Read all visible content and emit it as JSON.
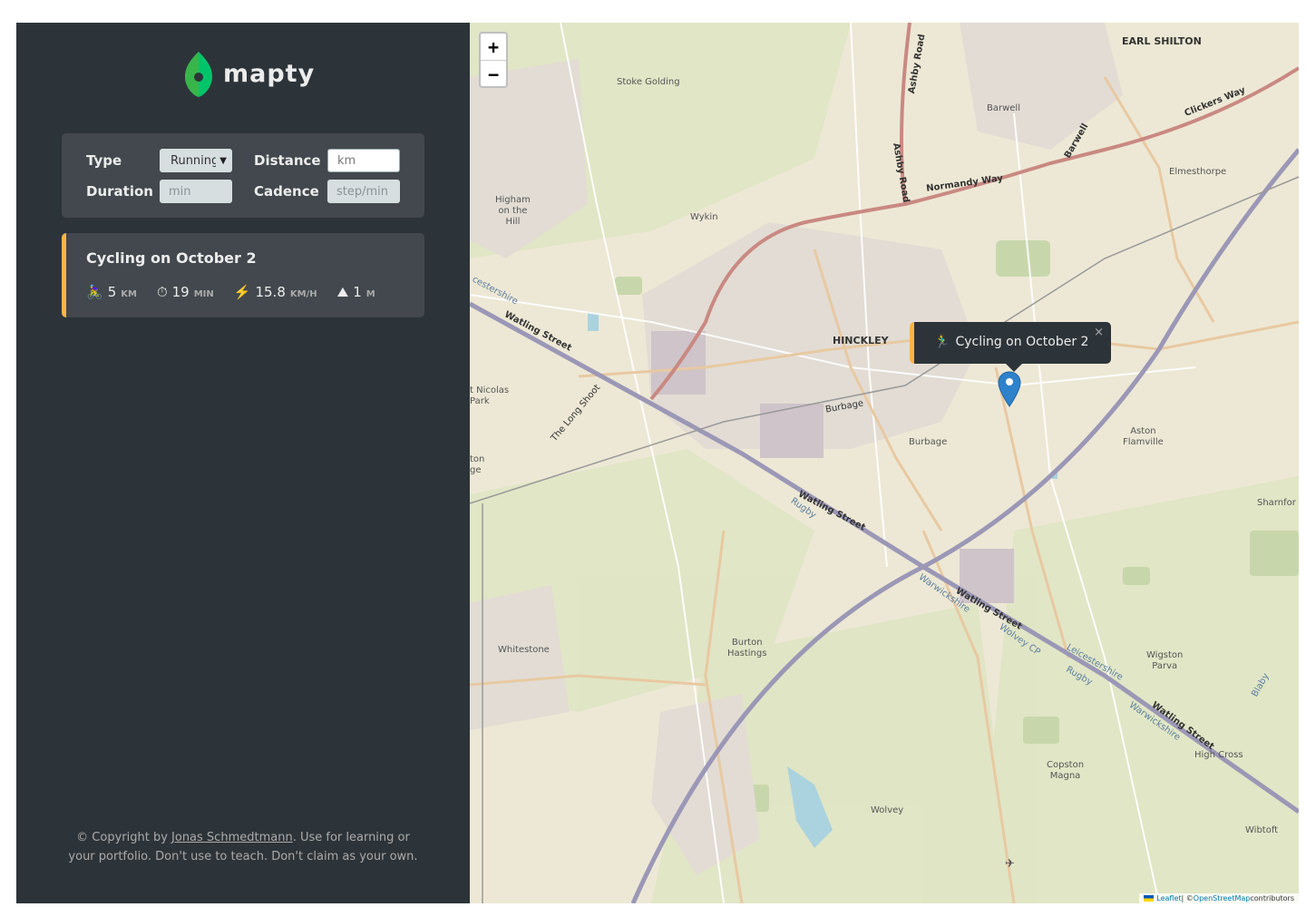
{
  "app": {
    "logo_text": "mapty"
  },
  "form": {
    "type_label": "Type",
    "type_value": "Running",
    "distance_label": "Distance",
    "distance_placeholder": "km",
    "duration_label": "Duration",
    "duration_placeholder": "min",
    "cadence_label": "Cadence",
    "cadence_placeholder": "step/min"
  },
  "workouts": [
    {
      "title": "Cycling on October 2",
      "color": "#ffb545",
      "details": [
        {
          "icon": "🚴‍♀️",
          "value": "5",
          "unit": "KM"
        },
        {
          "icon": "⏱",
          "value": "19",
          "unit": "MIN"
        },
        {
          "icon": "⚡️",
          "value": "15.8",
          "unit": "KM/H"
        },
        {
          "icon": "⛰",
          "value": "1",
          "unit": "M"
        }
      ]
    }
  ],
  "copyright": {
    "prefix": "© Copyright by ",
    "author": "Jonas Schmedtmann",
    "suffix": ". Use for learning or your portfolio. Don't use to teach. Don't claim as your own."
  },
  "map": {
    "zoom_in": "+",
    "zoom_out": "−",
    "popup_text": "Cycling on October 2",
    "popup_icon": "🏃‍♂️",
    "popup_close": "×",
    "attribution_leaflet": "Leaflet",
    "attribution_sep": " | © ",
    "attribution_osm": "OpenStreetMap",
    "attribution_suffix": " contributors",
    "places": {
      "earl_shilton": "EARL SHILTON",
      "stoke_golding": "Stoke Golding",
      "barwell": "Barwell",
      "higham": "Higham\non the\nHill",
      "wykin": "Wykin",
      "elmesthorpe": "Elmesthorpe",
      "hinckley": "HINCKLEY",
      "st_nicolas": "t Nicolas\nPark",
      "burbage": "Burbage",
      "aston_flamville": "Aston\nFlamville",
      "sharnford": "Sharnfor",
      "whitestone": "Whitestone",
      "burton_hastings": "Burton\nHastings",
      "wigston_parva": "Wigston\nParva",
      "copston_magna": "Copston\nMagna",
      "high_cross": "High Cross",
      "wolvey": "Wolvey",
      "wibtoft": "Wibtoft",
      "ton_ge": "ton\nge"
    },
    "roads": {
      "ashby_road": "Ashby Road",
      "ashby_road_2": "Ashby Road",
      "normandy_way": "Normandy Way",
      "clickers_way": "Clickers Way",
      "barwell_rd": "Barwell",
      "watling_1": "Watling Street",
      "watling_2": "Watling Street",
      "watling_3": "Watling Street",
      "watling_4": "Watling Street",
      "long_shoot": "The Long Shoot",
      "burbage_rd": "Burbage",
      "rugby_1": "Rugby",
      "rugby_2": "Rugby",
      "leicestershire_1": "Leicestershire",
      "leicestershire_2": "Leicestershire",
      "warwickshire_1": "Warwickshire",
      "warwickshire_2": "Warwickshire",
      "wolvey_cp": "Wolvey CP",
      "blaby": "Blaby",
      "cestershire": "cestershire"
    }
  }
}
